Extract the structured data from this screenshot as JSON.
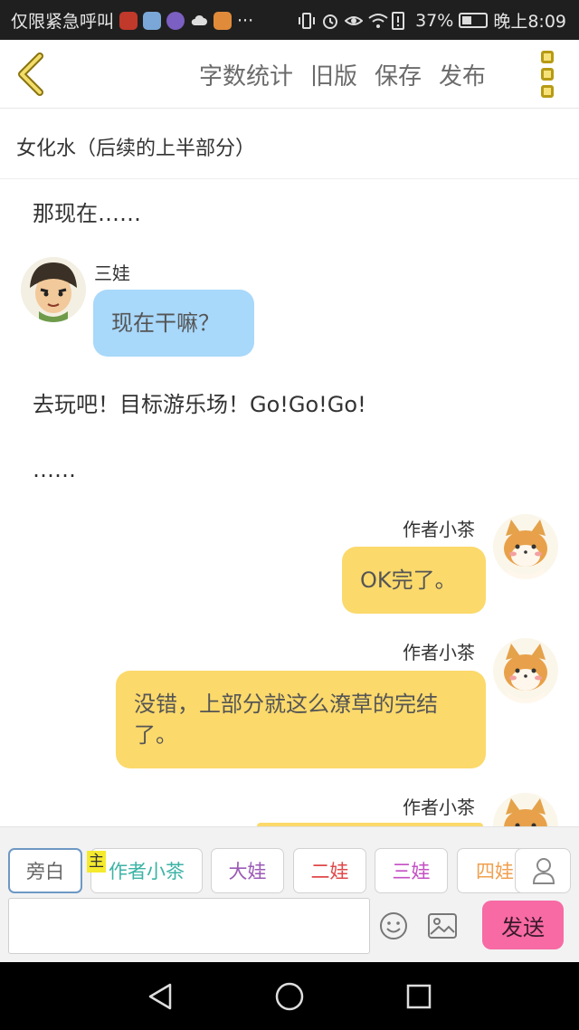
{
  "status_bar": {
    "carrier": "仅限紧急呼叫",
    "more_dots": "···",
    "battery": "37%",
    "time": "晚上8:09"
  },
  "toolbar": {
    "word_count": "字数统计",
    "old_version": "旧版",
    "save": "保存",
    "publish": "发布"
  },
  "story": {
    "title": "女化水（后续的上半部分）"
  },
  "messages": [
    {
      "type": "narration",
      "text": "那现在……"
    },
    {
      "type": "left",
      "speaker": "三娃",
      "text": "现在干嘛？"
    },
    {
      "type": "narration",
      "text": "去玩吧！目标游乐场！Go!Go!Go!"
    },
    {
      "type": "narration",
      "text": "……"
    },
    {
      "type": "right",
      "speaker": "作者小茶",
      "text": "OK完了。"
    },
    {
      "type": "right",
      "speaker": "作者小茶",
      "text": "没错，上部分就这么潦草的完结了。"
    },
    {
      "type": "right",
      "speaker": "作者小茶",
      "text": ""
    }
  ],
  "character_bar": {
    "characters": [
      {
        "label": "旁白",
        "color": "#666666"
      },
      {
        "label": "作者小茶",
        "color": "#3bb3a5"
      },
      {
        "label": "大娃",
        "color": "#9b59b6"
      },
      {
        "label": "二娃",
        "color": "#e04848"
      },
      {
        "label": "三娃",
        "color": "#c44fc4"
      },
      {
        "label": "四娃",
        "color": "#f0a050"
      }
    ],
    "owner_tag": "主"
  },
  "composer": {
    "send_label": "发送",
    "input_value": ""
  },
  "colors": {
    "blue_bubble": "#a8d8fa",
    "yellow_bubble": "#fbd96b",
    "send_button": "#f76aa4",
    "accent_icon": "#b79a14"
  }
}
